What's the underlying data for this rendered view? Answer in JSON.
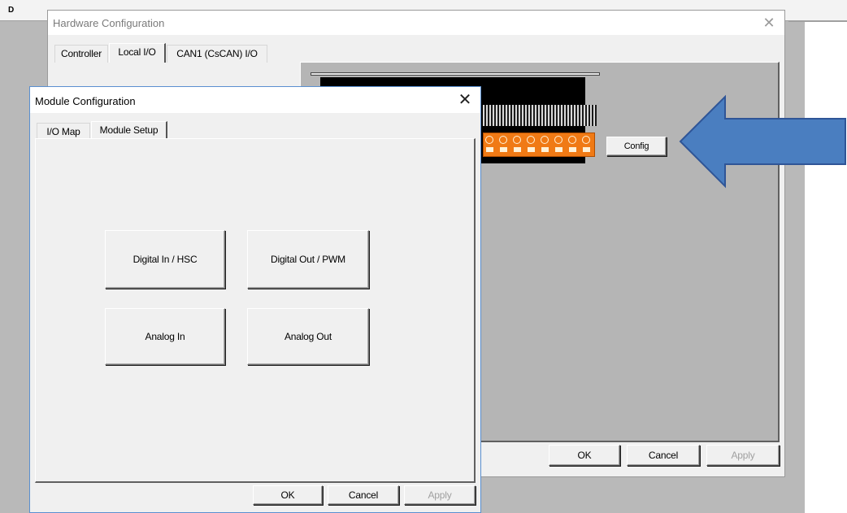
{
  "background_app": {
    "tab_label": "D"
  },
  "hardware_config": {
    "title": "Hardware Configuration",
    "close_glyph": "✕",
    "tabs": [
      {
        "label": "Controller",
        "active": false
      },
      {
        "label": "Local I/O",
        "active": true
      },
      {
        "label": "CAN1 (CsCAN) I/O",
        "active": false
      }
    ],
    "config_button": "Config",
    "buttons": {
      "ok": "OK",
      "cancel": "Cancel",
      "apply": "Apply"
    }
  },
  "module_config": {
    "title": "Module Configuration",
    "close_glyph": "✕",
    "tabs": [
      {
        "label": "I/O Map",
        "active": false
      },
      {
        "label": "Module Setup",
        "active": true
      }
    ],
    "setup_buttons": {
      "digital_in": "Digital In / HSC",
      "digital_out": "Digital Out / PWM",
      "analog_in": "Analog In",
      "analog_out": "Analog Out"
    },
    "buttons": {
      "ok": "OK",
      "cancel": "Cancel",
      "apply": "Apply"
    }
  },
  "colors": {
    "arrow_fill": "#4a7ec0",
    "arrow_stroke": "#2f5597",
    "terminal_orange": "#f07a15"
  },
  "icons": {
    "close": "close-icon",
    "arrow": "arrow-left-icon"
  }
}
